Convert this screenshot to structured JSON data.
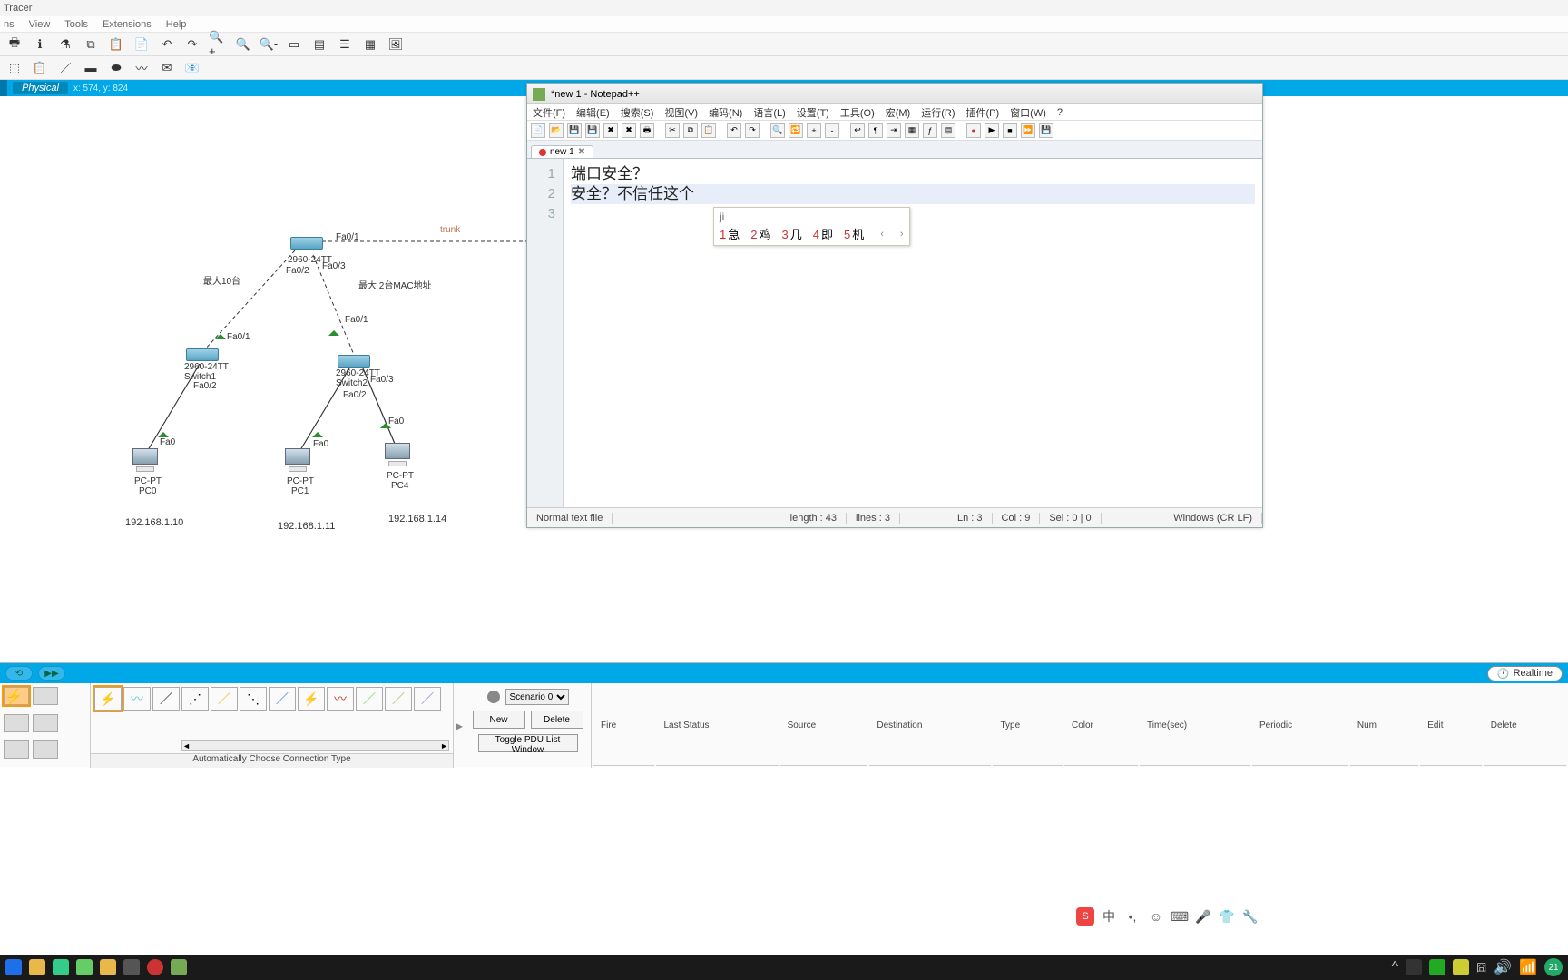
{
  "pt": {
    "title": "Tracer",
    "menu": [
      "ns",
      "View",
      "Tools",
      "Extensions",
      "Help"
    ],
    "physical_tab": "Physical",
    "coords": "x: 574, y: 824",
    "realtime": "Realtime",
    "auto_conn": "Automatically Choose Connection Type",
    "scenario": {
      "select": "Scenario 0",
      "new": "New",
      "delete": "Delete",
      "toggle": "Toggle PDU List Window"
    },
    "pdu_headers": [
      "Fire",
      "Last Status",
      "Source",
      "Destination",
      "Type",
      "Color",
      "Time(sec)",
      "Periodic",
      "Num",
      "Edit",
      "Delete"
    ]
  },
  "topo": {
    "trunk": "trunk",
    "note_left": "最大10台",
    "note_right": "最大 2台MAC地址",
    "sw_main": "2960-24TT",
    "sw1": "2960-24TT\nSwitch1",
    "sw2": "2960-24TT\nSwitch2",
    "ports": {
      "fa01": "Fa0/1",
      "fa02": "Fa0/2",
      "fa03": "Fa0/3",
      "fa0": "Fa0"
    },
    "pc0": {
      "type": "PC-PT",
      "name": "PC0",
      "ip": "192.168.1.10"
    },
    "pc1": {
      "type": "PC-PT",
      "name": "PC1",
      "ip": "192.168.1.11"
    },
    "pc4": {
      "type": "PC-PT",
      "name": "PC4",
      "ip": "192.168.1.14"
    }
  },
  "npp": {
    "title": "*new 1 - Notepad++",
    "menu": [
      "文件(F)",
      "编辑(E)",
      "搜索(S)",
      "视图(V)",
      "编码(N)",
      "语言(L)",
      "设置(T)",
      "工具(O)",
      "宏(M)",
      "运行(R)",
      "插件(P)",
      "窗口(W)",
      "?"
    ],
    "tab": "new 1",
    "lines": {
      "l1": "端口安全？",
      "l2": "",
      "l3": "安全？不信任这个"
    },
    "gutter": [
      "1",
      "2",
      "3"
    ],
    "status": {
      "mode": "Normal text file",
      "length": "length : 43",
      "lines": "lines : 3",
      "ln": "Ln : 3",
      "col": "Col : 9",
      "sel": "Sel : 0 | 0",
      "eol": "Windows (CR LF)"
    }
  },
  "ime": {
    "input": "ji",
    "candidates": [
      {
        "n": "1",
        "w": "急"
      },
      {
        "n": "2",
        "w": "鸡"
      },
      {
        "n": "3",
        "w": "几"
      },
      {
        "n": "4",
        "w": "即"
      },
      {
        "n": "5",
        "w": "机"
      }
    ],
    "sogou_label": "S",
    "lang": "中"
  },
  "tray": {
    "badge": "21"
  }
}
